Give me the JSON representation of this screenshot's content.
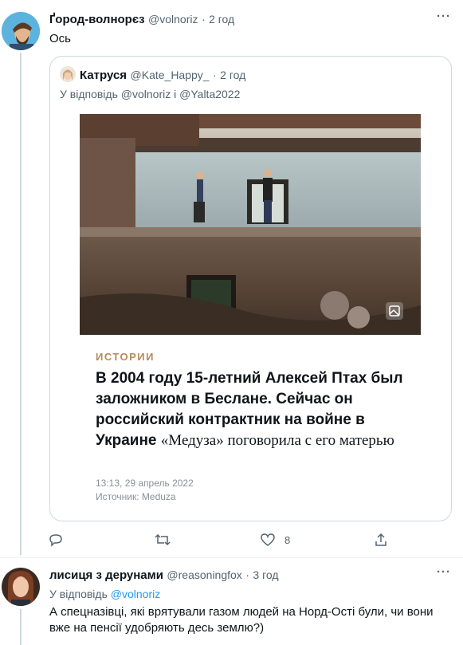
{
  "tweet1": {
    "name": "Ґород-волнорєз",
    "handle": "@volnoriz",
    "dot": "·",
    "time": "2 год",
    "text": "Ось",
    "more_icon": "more-horizontal-icon"
  },
  "quoted": {
    "name": "Катруся",
    "handle": "@Kate_Happy_",
    "dot": "·",
    "time": "2 год",
    "reply_prefix": "У відповідь",
    "reply_user1": "@volnoriz",
    "reply_and": "і",
    "reply_user2": "@Yalta2022",
    "article": {
      "category": "ИСТОРИИ",
      "title_bold": "В 2004 году 15-летний Алексей Птах был заложником в Беслане. Сейчас он российский контрактник на войне в Украине",
      "title_serif": "«Медуза» поговорила с его матерью",
      "date": "13:13, 29 апрель 2022",
      "source": "Источник: Meduza"
    }
  },
  "actions": {
    "reply_icon": "reply-icon",
    "retweet_icon": "retweet-icon",
    "like_icon": "heart-icon",
    "like_count": "8",
    "share_icon": "share-icon"
  },
  "tweet2": {
    "name": "лисиця з дерунами",
    "handle": "@reasoningfox",
    "dot": "·",
    "time": "3 год",
    "reply_prefix": "У відповідь",
    "reply_user": "@volnoriz",
    "text": "А спецназівці, які врятували газом людей на Норд-Ості були, чи вони вже на пенсії удобряють десь землю?)"
  },
  "colors": {
    "accent": "#1d9bf0",
    "muted": "#536471",
    "border": "#cfd9de",
    "category": "#b88b58"
  }
}
